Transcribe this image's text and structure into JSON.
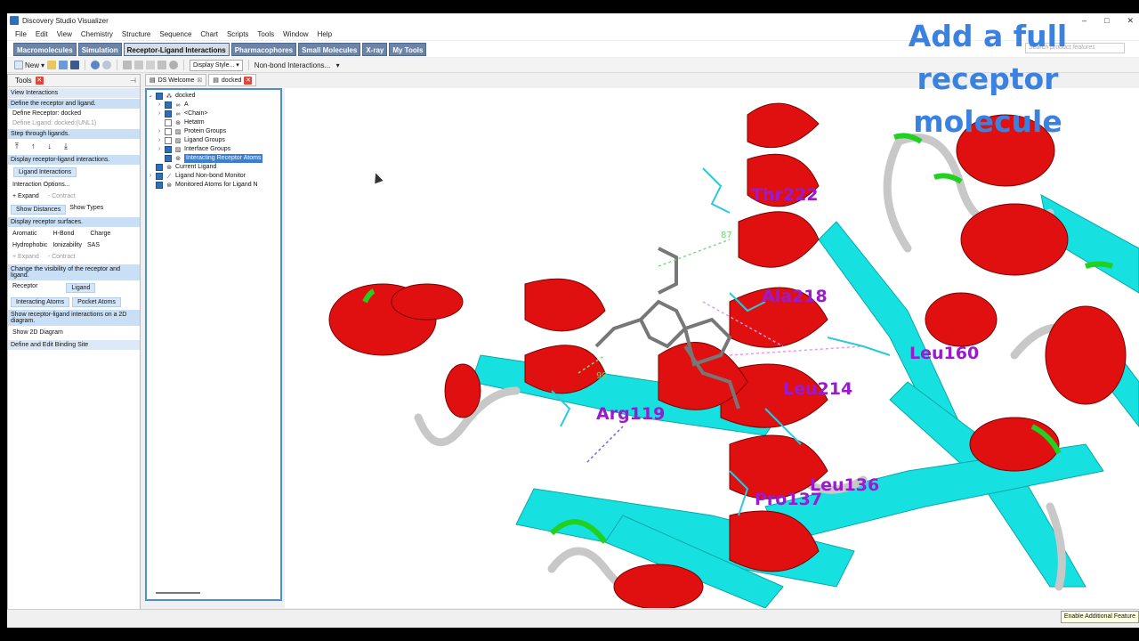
{
  "app": {
    "title": "Discovery Studio Visualizer",
    "window_controls": [
      "–",
      "□",
      "✕"
    ]
  },
  "menu": [
    "File",
    "Edit",
    "View",
    "Chemistry",
    "Structure",
    "Sequence",
    "Chart",
    "Scripts",
    "Tools",
    "Window",
    "Help"
  ],
  "ribbon_tabs": [
    {
      "label": "Macromolecules"
    },
    {
      "label": "Simulation"
    },
    {
      "label": "Receptor-Ligand Interactions"
    },
    {
      "label": "Pharmacophores"
    },
    {
      "label": "Small Molecules"
    },
    {
      "label": "X-ray"
    },
    {
      "label": "My Tools"
    }
  ],
  "search": {
    "placeholder": "Search product features"
  },
  "toolbar": {
    "new_label": "New",
    "display_style": "Display Style...",
    "nonbond": "Non-bond Interactions..."
  },
  "tools_panel": {
    "title": "Tools",
    "sections": {
      "view_interactions": "View Interactions",
      "define": "Define the receptor and ligand.",
      "define_receptor": "Define Receptor: docked",
      "define_ligand": "Define Ligand: docked:(UNL1)",
      "step": "Step through ligands.",
      "display_interactions": "Display receptor-ligand interactions.",
      "ligand_interactions": "Ligand Interactions",
      "interaction_options": "Interaction Options...",
      "expand": "Expand",
      "contract": "Contract",
      "show_distances": "Show Distances",
      "show_types": "Show Types",
      "display_surfaces": "Display receptor surfaces.",
      "aromatic": "Aromatic",
      "hbond": "H-Bond",
      "charge": "Charge",
      "hydrophobic": "Hydrophobic",
      "ionizability": "Ionizability",
      "sas": "SAS",
      "change_visibility": "Change the visibility of the receptor and ligand.",
      "receptor": "Receptor",
      "ligand": "Ligand",
      "interacting_atoms": "Interacting Atoms",
      "pocket_atoms": "Pocket Atoms",
      "show_2d_text": "Show receptor-ligand interactions on a 2D diagram.",
      "show_2d": "Show 2D Diagram",
      "binding_site": "Define and Edit Binding Site"
    }
  },
  "doc_tabs": [
    {
      "label": "DS Welcome"
    },
    {
      "label": "docked"
    }
  ],
  "tree": [
    {
      "label": "docked",
      "twist": "⌄",
      "checked": true
    },
    {
      "label": "A",
      "twist": "›",
      "checked": true
    },
    {
      "label": "<Chain>",
      "twist": "›",
      "checked": true
    },
    {
      "label": "Hetatm",
      "twist": "",
      "checked": false
    },
    {
      "label": "Protein Groups",
      "twist": "›",
      "checked": false
    },
    {
      "label": "Ligand Groups",
      "twist": "›",
      "checked": false
    },
    {
      "label": "Interface Groups",
      "twist": "›",
      "checked": true
    },
    {
      "label": "Interacting Receptor Atoms",
      "twist": "",
      "checked": true
    },
    {
      "label": "Current Ligand",
      "twist": "",
      "checked": true
    },
    {
      "label": "Ligand Non-bond Monitor",
      "twist": "›",
      "checked": true
    },
    {
      "label": "Monitored Atoms for Ligand N",
      "twist": "",
      "checked": true
    }
  ],
  "residue_labels": [
    "Thr222",
    "Ala218",
    "Leu160",
    "Leu214",
    "Arg119",
    "Pro137",
    "Leu136"
  ],
  "distance_labels": [
    "87",
    "99"
  ],
  "overlay": {
    "line1": "Add a full",
    "line2": "receptor",
    "line3": "molecule"
  },
  "status": {
    "tip": "Enable Additional Feature"
  },
  "colors": {
    "helix": "#e01010",
    "sheet": "#17e0e0",
    "coil": "#c8c8c8",
    "turn": "#22d022",
    "label": "#9a1ad0",
    "overlay": "#3b82e0"
  }
}
